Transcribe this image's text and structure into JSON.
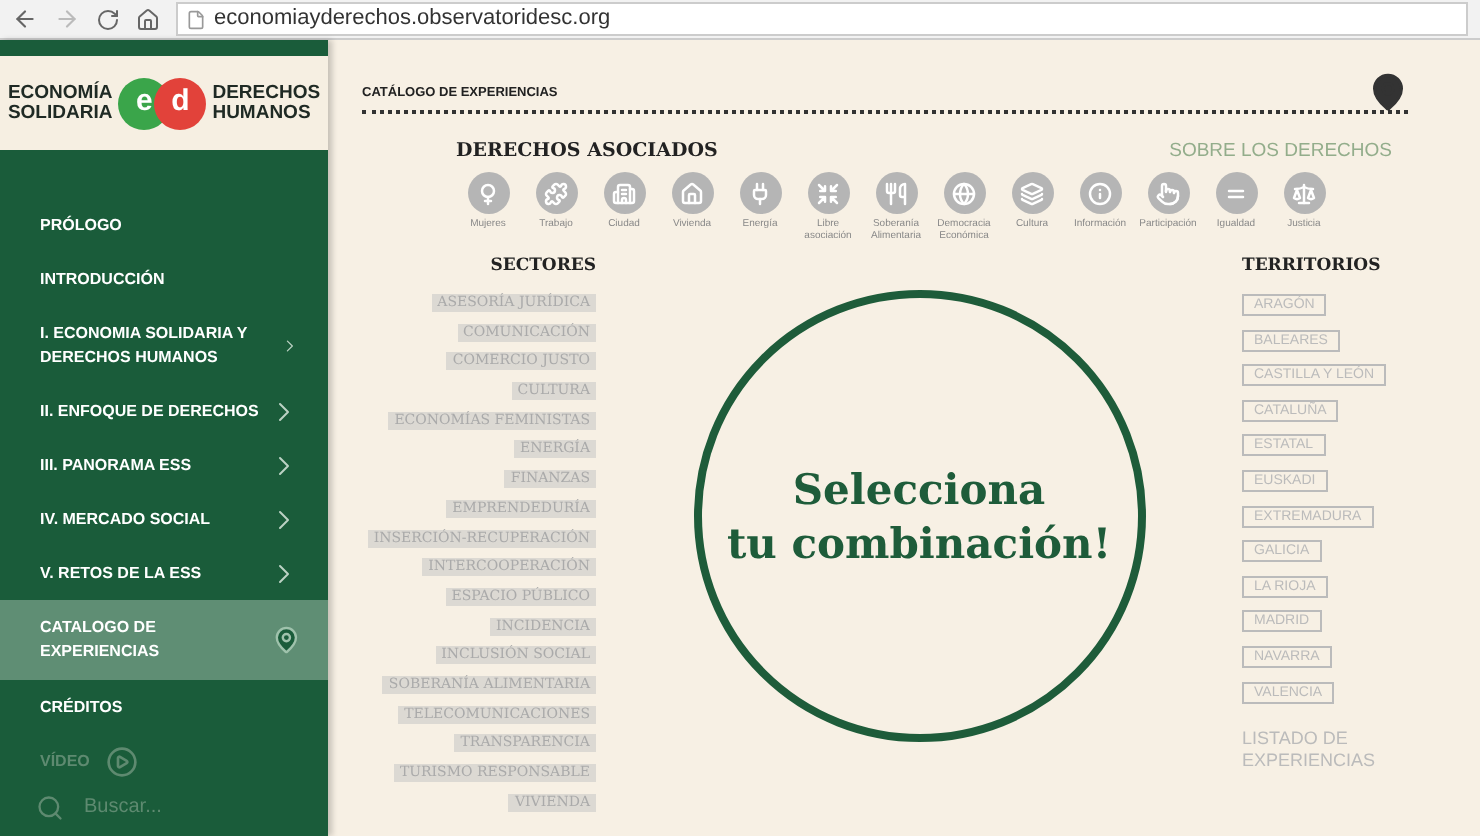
{
  "browser": {
    "url": "economiayderechos.observatoridesc.org"
  },
  "logo": {
    "left_top": "ECONOMÍA",
    "left_bottom": "SOLIDARIA",
    "mark_left": "e",
    "mark_right": "d",
    "right_top": "DERECHOS",
    "right_bottom": "HUMANOS"
  },
  "nav": [
    {
      "kind": "link",
      "label": "PRÓLOGO",
      "expandable": false,
      "selected": false
    },
    {
      "kind": "link",
      "label": "INTRODUCCIÓN",
      "expandable": false,
      "selected": false
    },
    {
      "kind": "link",
      "label": "I. ECONOMIA SOLIDARIA Y DERECHOS HUMANOS",
      "expandable": true,
      "selected": false
    },
    {
      "kind": "link",
      "label": "II. ENFOQUE DE DERECHOS",
      "expandable": true,
      "selected": false
    },
    {
      "kind": "link",
      "label": "III. PANORAMA ESS",
      "expandable": true,
      "selected": false
    },
    {
      "kind": "link",
      "label": "IV. MERCADO SOCIAL",
      "expandable": true,
      "selected": false
    },
    {
      "kind": "link",
      "label": "V. RETOS DE LA ESS",
      "expandable": true,
      "selected": false
    },
    {
      "kind": "pin",
      "label": "CATALOGO DE EXPERIENCIAS",
      "expandable": false,
      "selected": true
    },
    {
      "kind": "link",
      "label": "CRÉDITOS",
      "expandable": false,
      "selected": false
    },
    {
      "kind": "video",
      "label": "VÍDEO",
      "expandable": false,
      "selected": false
    }
  ],
  "search": {
    "placeholder": "Buscar..."
  },
  "page_title": "CATÁLOGO DE EXPERIENCIAS",
  "rights": {
    "title": "DERECHOS ASOCIADOS",
    "link": "SOBRE LOS DERECHOS",
    "items": [
      "Mujeres",
      "Trabajo",
      "Ciudad",
      "Vivienda",
      "Energía",
      "Libre asociación",
      "Soberanía Alimentaria",
      "Democracia Económica",
      "Cultura",
      "Información",
      "Participación",
      "Igualdad",
      "Justicia"
    ]
  },
  "sectors": {
    "title": "SECTORES",
    "items": [
      "ASESORÍA JURÍDICA",
      "COMUNICACIÓN",
      "COMERCIO JUSTO",
      "CULTURA",
      "ECONOMÍAS FEMINISTAS",
      "ENERGÍA",
      "FINANZAS",
      "EMPRENDEDURÍA",
      "INSERCIÓN-RECUPERACIÓN",
      "INTERCOOPERACIÓN",
      "ESPACIO PÚBLICO",
      "INCIDENCIA",
      "INCLUSIÓN SOCIAL",
      "SOBERANÍA ALIMENTARIA",
      "TELECOMUNICACIONES",
      "TRANSPARENCIA",
      "TURISMO RESPONSABLE",
      "VIVIENDA"
    ]
  },
  "center": {
    "line1": "Selecciona",
    "line2": "tu combinación!"
  },
  "territories": {
    "title": "TERRITORIOS",
    "items": [
      "ARAGÓN",
      "BALEARES",
      "CASTILLA Y LEÓN",
      "CATALUÑA",
      "ESTATAL",
      "EUSKADI",
      "EXTREMADURA",
      "GALICIA",
      "LA RIOJA",
      "MADRID",
      "NAVARRA",
      "VALENCIA"
    ],
    "link": "LISTADO DE EXPERIENCIAS"
  }
}
